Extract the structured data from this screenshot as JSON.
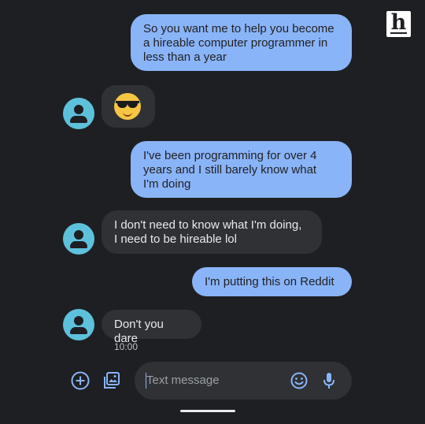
{
  "logo": {
    "letter": "h"
  },
  "messages": [
    {
      "direction": "outgoing",
      "text": "So you want me to help you become\na hireable computer programmer in\nless than a year"
    },
    {
      "direction": "incoming",
      "emoji": "smiling-face-with-sunglasses"
    },
    {
      "direction": "outgoing",
      "text": "I've been programming for over 4\nyears and I still barely know what\nI'm doing"
    },
    {
      "direction": "incoming",
      "text": "I don't need to know what I'm doing,\nI need to be hireable lol"
    },
    {
      "direction": "outgoing",
      "text": "I'm putting this on Reddit"
    },
    {
      "direction": "incoming",
      "text": "Don't you dare"
    }
  ],
  "last_timestamp": "10:00",
  "compose": {
    "placeholder": "Text message",
    "icons": [
      "add-icon",
      "gallery-icon",
      "emoji-icon",
      "microphone-icon"
    ]
  },
  "colors": {
    "background": "#1e1f22",
    "outgoing_bubble": "#8ab4f8",
    "incoming_bubble": "#303134",
    "avatar": "#5ec1dc",
    "icon_accent": "#8ab4f8"
  }
}
